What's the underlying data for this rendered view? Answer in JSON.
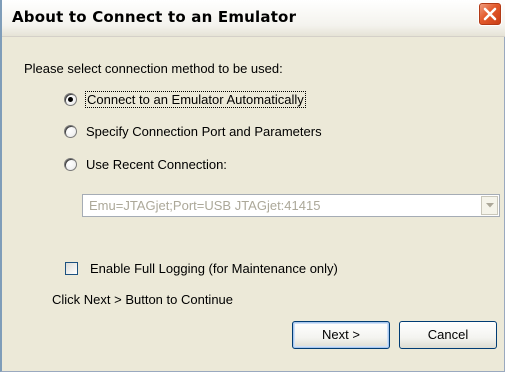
{
  "window": {
    "title": "About to Connect to an Emulator",
    "close_icon": "close-icon"
  },
  "prompt": "Please select connection method to be used:",
  "options": [
    {
      "label": "Connect to an Emulator Automatically",
      "selected": true
    },
    {
      "label": "Specify Connection Port and Parameters",
      "selected": false
    },
    {
      "label": "Use Recent Connection:",
      "selected": false
    }
  ],
  "recent_connection": {
    "value": "Emu=JTAGjet;Port=USB JTAGjet:41415",
    "enabled": false
  },
  "logging_checkbox": {
    "label": "Enable Full Logging (for Maintenance only)",
    "checked": false
  },
  "hint": "Click Next > Button to Continue",
  "buttons": {
    "next": "Next >",
    "cancel": "Cancel"
  },
  "colors": {
    "dialog_bg": "#ece9d8",
    "close_red": "#e35a2c",
    "disabled_text": "#aca899"
  }
}
